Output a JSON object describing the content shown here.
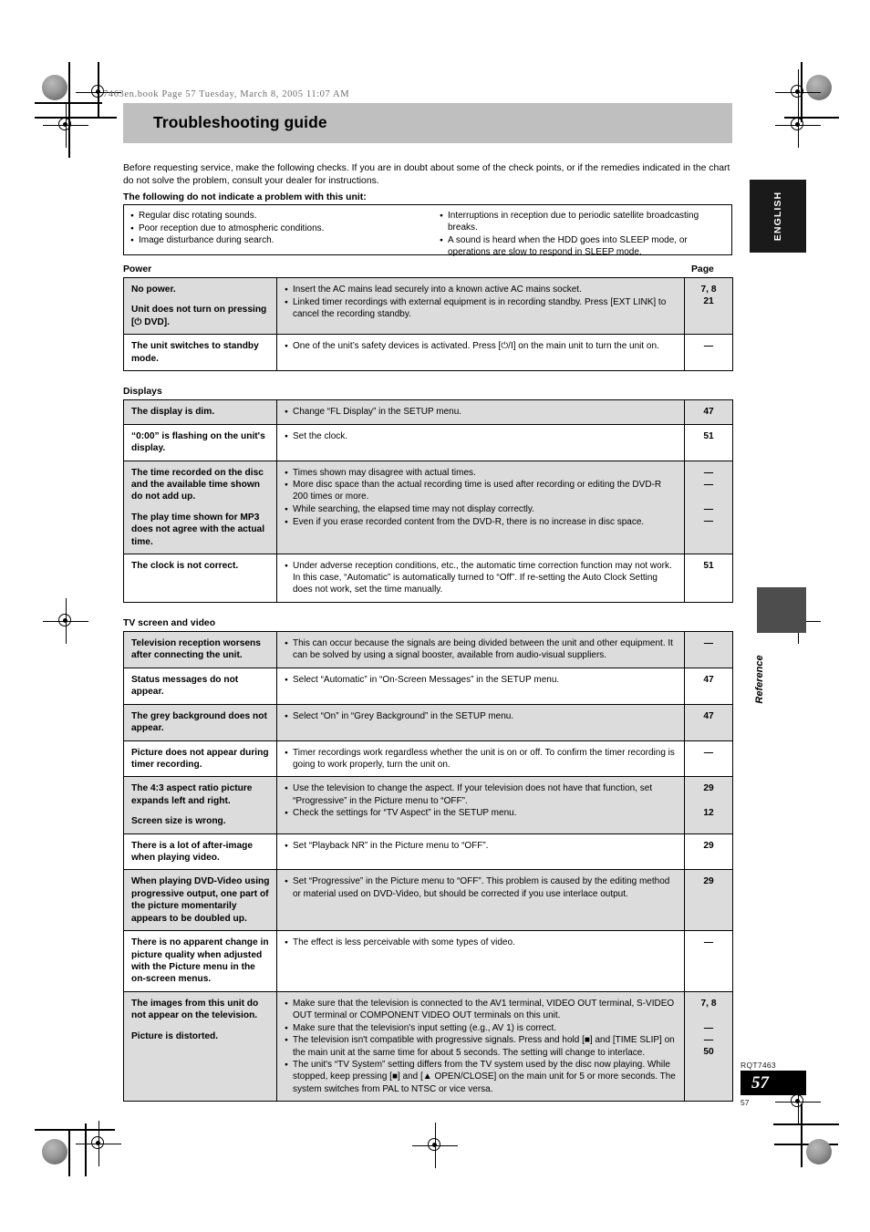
{
  "print_slug": "7463en.book  Page 57  Tuesday, March 8, 2005  11:07 AM",
  "title": "Troubleshooting guide",
  "intro": "Before requesting service, make the following checks. If you are in doubt about some of the check points, or if the remedies indicated in the chart do not solve the problem, consult your dealer for instructions.",
  "subhead": "The following do not indicate a problem with this unit:",
  "not_a_problem": {
    "left": [
      "Regular disc rotating sounds.",
      "Poor reception due to atmospheric conditions.",
      "Image disturbance during search."
    ],
    "right": [
      "Interruptions in reception due to periodic satellite broadcasting breaks.",
      "A sound is heard when the HDD goes into SLEEP mode, or operations are slow to respond in SLEEP mode."
    ]
  },
  "page_column_heading": "Page",
  "sections": [
    {
      "caption": "Power",
      "rows": [
        {
          "shade": true,
          "symptoms": [
            "No power.",
            "Unit does not turn on pressing [⏻ DVD]."
          ],
          "remedies": [
            "Insert the AC mains lead securely into a known active AC mains socket.",
            "Linked timer recordings with external equipment is in recording standby. Press [EXT LINK] to cancel the recording standby."
          ],
          "pages": [
            "7, 8",
            "21"
          ]
        },
        {
          "shade": false,
          "symptoms": [
            "The unit switches to standby mode."
          ],
          "remedies": [
            "One of the unit’s safety devices is activated. Press [⏻/I] on the main unit to turn the unit on."
          ],
          "pages": [
            "—"
          ]
        }
      ]
    },
    {
      "caption": "Displays",
      "rows": [
        {
          "shade": true,
          "symptoms": [
            "The display is dim."
          ],
          "remedies": [
            "Change “FL Display” in the SETUP menu."
          ],
          "pages": [
            "47"
          ]
        },
        {
          "shade": false,
          "symptoms": [
            "“0:00” is flashing on the unit's display."
          ],
          "remedies": [
            "Set the clock."
          ],
          "pages": [
            "51"
          ]
        },
        {
          "shade": true,
          "symptoms": [
            "The time recorded on the disc and the available time shown do not add up.",
            "The play time shown for MP3 does not agree with the actual time."
          ],
          "remedies": [
            "Times shown may disagree with actual times.",
            "More disc space than the actual recording time is used after recording or editing the DVD-R 200 times or more.",
            "While searching, the elapsed time may not display correctly.",
            "Even if you erase recorded content from the DVD-R, there is no increase in disc space."
          ],
          "pages": [
            "—",
            "—",
            "",
            "—",
            "—"
          ]
        },
        {
          "shade": false,
          "symptoms": [
            "The clock is not correct."
          ],
          "remedies": [
            "Under adverse reception conditions, etc., the automatic time correction function may not work. In this case, “Automatic” is automatically turned to “Off”. If re-setting the Auto Clock Setting does not work, set the time manually."
          ],
          "pages": [
            "51"
          ]
        }
      ]
    },
    {
      "caption": "TV screen and video",
      "rows": [
        {
          "shade": true,
          "symptoms": [
            "Television reception worsens after connecting the unit."
          ],
          "remedies": [
            "This can occur because the signals are being divided between the unit and other equipment. It can be solved by using a signal booster, available from audio-visual suppliers."
          ],
          "pages": [
            "—"
          ]
        },
        {
          "shade": false,
          "symptoms": [
            "Status messages do not appear."
          ],
          "remedies": [
            "Select “Automatic” in “On-Screen Messages” in the SETUP menu."
          ],
          "pages": [
            "47"
          ]
        },
        {
          "shade": true,
          "symptoms": [
            "The grey background does not appear."
          ],
          "remedies": [
            "Select “On” in “Grey Background” in the SETUP menu."
          ],
          "pages": [
            "47"
          ]
        },
        {
          "shade": false,
          "symptoms": [
            "Picture does not appear during timer recording."
          ],
          "remedies": [
            "Timer recordings work regardless whether the unit is on or off. To confirm the timer recording is going to work properly, turn the unit on."
          ],
          "pages": [
            "—"
          ]
        },
        {
          "shade": true,
          "symptoms": [
            "The 4:3 aspect ratio picture expands left and right.",
            "Screen size is wrong."
          ],
          "remedies": [
            "Use the television to change the aspect. If your television does not have that function, set “Progressive” in the Picture menu to “OFF”.",
            "Check the settings for “TV Aspect” in the SETUP menu."
          ],
          "pages": [
            "29",
            "",
            "12"
          ]
        },
        {
          "shade": false,
          "symptoms": [
            "There is a lot of after-image when playing video."
          ],
          "remedies": [
            "Set “Playback NR” in the Picture menu to “OFF”."
          ],
          "pages": [
            "29"
          ]
        },
        {
          "shade": true,
          "symptoms": [
            "When playing DVD-Video using progressive output, one part of the picture momentarily appears to be doubled up."
          ],
          "remedies": [
            "Set “Progressive” in the Picture menu to “OFF”. This problem is caused by the editing method or material used on DVD-Video, but should be corrected if you use interlace output."
          ],
          "pages": [
            "29"
          ]
        },
        {
          "shade": false,
          "symptoms": [
            "There is no apparent change in picture quality when adjusted with the Picture menu in the on-screen menus."
          ],
          "remedies": [
            "The effect is less perceivable with some types of video."
          ],
          "pages": [
            "—"
          ]
        },
        {
          "shade": true,
          "symptoms": [
            "The images from this unit do not appear on the television.",
            "Picture is distorted."
          ],
          "remedies": [
            "Make sure that the television is connected to the AV1 terminal, VIDEO OUT terminal, S-VIDEO OUT terminal or COMPONENT VIDEO OUT terminals on this unit.",
            "Make sure that the television's input setting (e.g., AV 1) is correct.",
            "The television isn't compatible with progressive signals. Press and hold [■] and [TIME SLIP] on the main unit at the same time for about 5 seconds. The setting will change to interlace.",
            "The unit's “TV System” setting differs from the TV system used by the disc now playing. While stopped, keep pressing [■] and [▲ OPEN/CLOSE] on the main unit for 5 or more seconds. The system switches from PAL to NTSC or vice versa."
          ],
          "pages": [
            "7, 8",
            "",
            "—",
            "—",
            "50"
          ]
        }
      ]
    }
  ],
  "tabs": {
    "english": "ENGLISH",
    "reference": "Reference"
  },
  "footer": {
    "model_code": "RQT7463",
    "page_badge": "57",
    "page_number": "57"
  }
}
